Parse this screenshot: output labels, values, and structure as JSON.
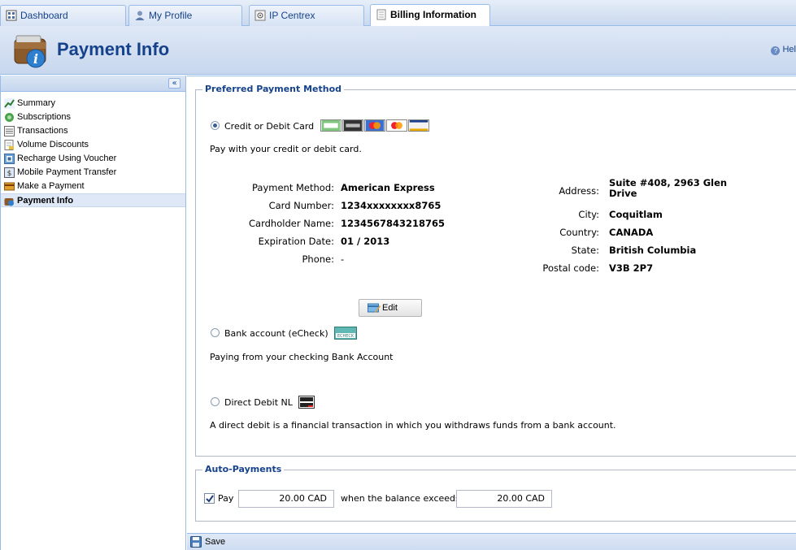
{
  "tabs": [
    {
      "label": "Dashboard",
      "icon": "dashboard-icon",
      "active": false
    },
    {
      "label": "My Profile",
      "icon": "user-icon",
      "active": false
    },
    {
      "label": "IP Centrex",
      "icon": "network-icon",
      "active": false
    },
    {
      "label": "Billing Information",
      "icon": "document-icon",
      "active": true
    }
  ],
  "header": {
    "title": "Payment Info",
    "help_label": "Hel"
  },
  "sidebar": {
    "items": [
      {
        "label": "Summary",
        "icon": "chart-icon"
      },
      {
        "label": "Subscriptions",
        "icon": "subscriptions-icon"
      },
      {
        "label": "Transactions",
        "icon": "list-icon"
      },
      {
        "label": "Volume Discounts",
        "icon": "discount-icon"
      },
      {
        "label": "Recharge Using Voucher",
        "icon": "voucher-icon"
      },
      {
        "label": "Mobile Payment Transfer",
        "icon": "mobile-transfer-icon"
      },
      {
        "label": "Make a Payment",
        "icon": "payment-icon"
      },
      {
        "label": "Payment Info",
        "icon": "wallet-info-icon",
        "active": true
      }
    ]
  },
  "preferred": {
    "legend": "Preferred Payment Method",
    "credit": {
      "label": "Credit or Debit Card",
      "description": "Pay with your credit or debit card.",
      "selected": true,
      "details": {
        "method_label": "Payment Method:",
        "method_value": "American Express",
        "card_label": "Card Number:",
        "card_value": "1234xxxxxxxx8765",
        "holder_label": "Cardholder Name:",
        "holder_value": "1234567843218765",
        "exp_label": "Expiration Date:",
        "exp_value": "01 / 2013",
        "phone_label": "Phone:",
        "phone_value": "-",
        "address_label": "Address:",
        "address_value": "Suite #408, 2963 Glen Drive",
        "city_label": "City:",
        "city_value": "Coquitlam",
        "country_label": "Country:",
        "country_value": "CANADA",
        "state_label": "State:",
        "state_value": "British Columbia",
        "postal_label": "Postal code:",
        "postal_value": "V3B 2P7"
      },
      "edit_label": "Edit"
    },
    "bank": {
      "label": "Bank account (eCheck)",
      "description": "Paying from your checking Bank Account",
      "selected": false
    },
    "debit": {
      "label": "Direct Debit NL",
      "description": "A direct debit is a financial transaction in which you withdraws funds from a bank account.",
      "selected": false
    }
  },
  "auto": {
    "legend": "Auto-Payments",
    "checked": true,
    "pay_label": "Pay",
    "pay_value": "20.00 CAD",
    "when_label": "when the balance exceeds",
    "threshold_value": "20.00 CAD"
  },
  "toolbar": {
    "save_label": "Save"
  },
  "colors": {
    "accent": "#15428b",
    "border": "#99bbe8"
  }
}
